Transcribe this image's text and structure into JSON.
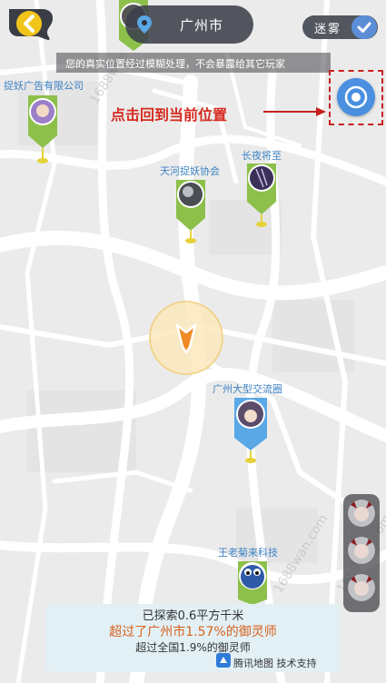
{
  "header": {
    "city": "广州市",
    "fog_toggle_label": "迷雾",
    "privacy_notice": "您的真实位置经过模糊处理，不会暴露给其它玩家"
  },
  "locate": {
    "hint": "点击回到当前位置"
  },
  "pins": [
    {
      "label": "捉妖广告有限公司"
    },
    {
      "label": "天河捉妖协会"
    },
    {
      "label": "长夜将至"
    },
    {
      "label": "广州大型交流圈"
    },
    {
      "label": "王老菊来科技"
    }
  ],
  "stats": {
    "explored": "已探索0.6平方千米",
    "city_rank": "超过了广州市1.57%的御灵师",
    "national_rank": "超过全国1.9%的御灵师",
    "map_credit": "腾讯地图 技术支持"
  },
  "watermarks": [
    "1688wan",
    "1688wan.com",
    "1688wan.com"
  ],
  "colors": {
    "accent_blue": "#4a8fe0",
    "hint_red": "#d42a1f",
    "rank_orange": "#d8601c",
    "pin_green": "#8cc04a",
    "pin_blue": "#5aa8e6"
  }
}
